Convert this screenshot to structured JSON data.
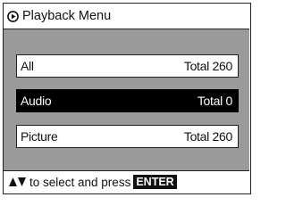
{
  "title": {
    "icon": "play-circle-icon",
    "text": "Playback Menu"
  },
  "menu": {
    "items": [
      {
        "label": "All",
        "count_text": "Total 260",
        "selected": false
      },
      {
        "label": "Audio",
        "count_text": "Total 0",
        "selected": true
      },
      {
        "label": "Picture",
        "count_text": "Total 260",
        "selected": false
      }
    ]
  },
  "footer": {
    "icon": "up-down-arrows-icon",
    "hint_text": "to select and press",
    "key_label": "ENTER"
  },
  "colors": {
    "panel_background": "#9a9a9a",
    "selected_background": "#000000",
    "selected_text": "#ffffff",
    "normal_background": "#ffffff"
  }
}
